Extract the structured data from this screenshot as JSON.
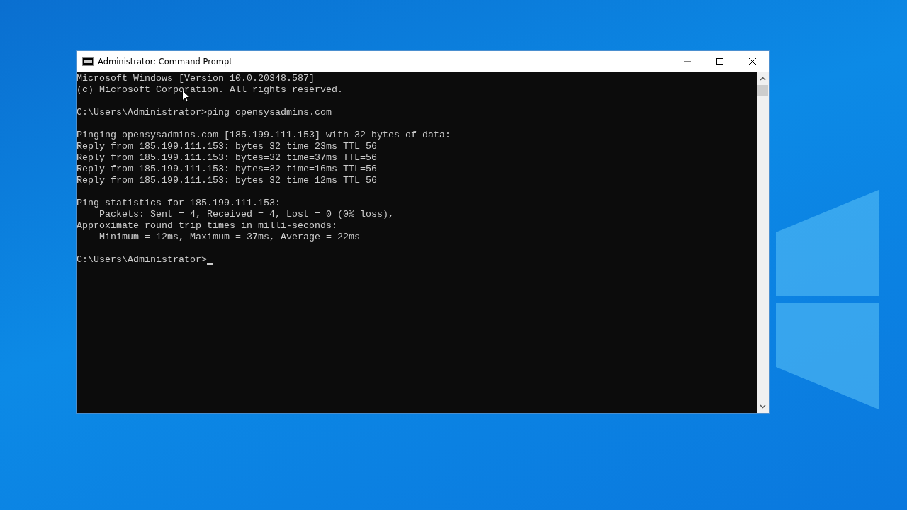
{
  "window": {
    "title": "Administrator: Command Prompt"
  },
  "console": {
    "blocks": [
      [
        "Microsoft Windows [Version 10.0.20348.587]",
        "(c) Microsoft Corporation. All rights reserved."
      ],
      [
        "C:\\Users\\Administrator>ping opensysadmins.com"
      ],
      [
        "Pinging opensysadmins.com [185.199.111.153] with 32 bytes of data:",
        "Reply from 185.199.111.153: bytes=32 time=23ms TTL=56",
        "Reply from 185.199.111.153: bytes=32 time=37ms TTL=56",
        "Reply from 185.199.111.153: bytes=32 time=16ms TTL=56",
        "Reply from 185.199.111.153: bytes=32 time=12ms TTL=56"
      ],
      [
        "Ping statistics for 185.199.111.153:",
        "    Packets: Sent = 4, Received = 4, Lost = 0 (0% loss),",
        "Approximate round trip times in milli-seconds:",
        "    Minimum = 12ms, Maximum = 37ms, Average = 22ms"
      ]
    ],
    "prompt": "C:\\Users\\Administrator>"
  }
}
